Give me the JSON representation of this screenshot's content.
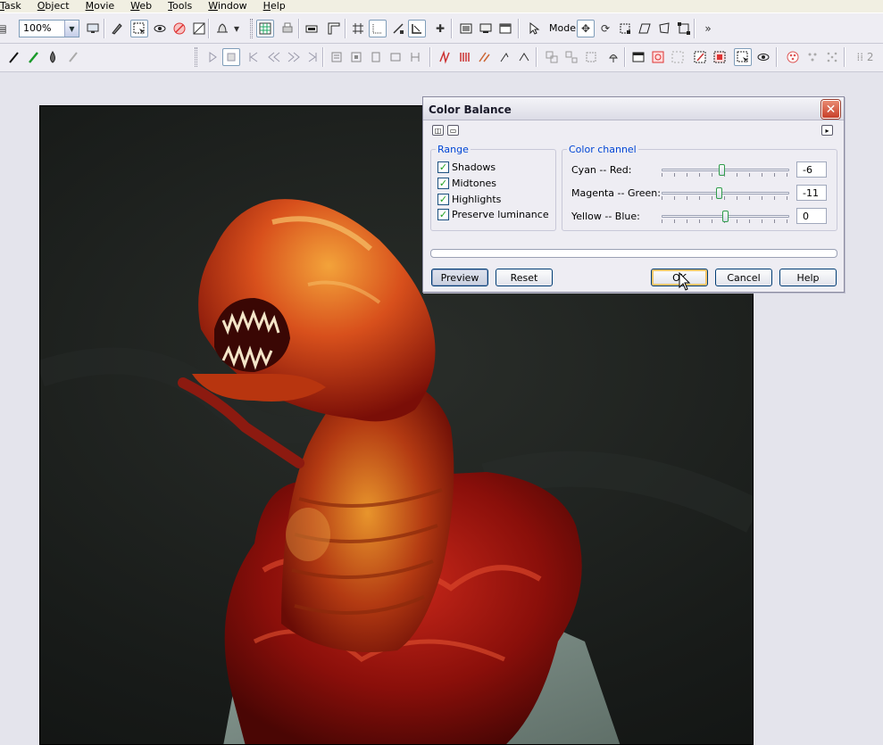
{
  "menu": {
    "items": [
      "Task",
      "Object",
      "Movie",
      "Web",
      "Tools",
      "Window",
      "Help"
    ],
    "underlined_letters": [
      "T",
      "O",
      "M",
      "W",
      "T",
      "W",
      "H"
    ]
  },
  "toolbar": {
    "zoom_value": "100%",
    "mode_label": "Mode"
  },
  "dialog": {
    "title": "Color Balance",
    "close_glyph": "✕",
    "range": {
      "legend": "Range",
      "options": [
        {
          "label": "Shadows",
          "checked": true
        },
        {
          "label": "Midtones",
          "checked": true
        },
        {
          "label": "Highlights",
          "checked": true
        },
        {
          "label": "Preserve luminance",
          "checked": true
        }
      ]
    },
    "color_channel": {
      "legend": "Color channel",
      "sliders": [
        {
          "label": "Cyan -- Red:",
          "value": "-6",
          "numeric": -6
        },
        {
          "label": "Magenta -- Green:",
          "value": "-11",
          "numeric": -11
        },
        {
          "label": "Yellow -- Blue:",
          "value": "0",
          "numeric": 0
        }
      ],
      "slider_min": -100,
      "slider_max": 100
    },
    "buttons": {
      "preview": "Preview",
      "reset": "Reset",
      "ok": "OK",
      "cancel": "Cancel",
      "help": "Help"
    }
  },
  "colors": {
    "accent_blue": "#0046d5",
    "check_green": "#21a121",
    "close_red": "#c8402a"
  },
  "icons": {
    "toolbar1": [
      "layers-icon",
      "preview-monitor-icon",
      "pen-tool-icon",
      "select-icon",
      "eye-icon",
      "no-icon",
      "crop-icon",
      "bell-icon",
      "grid-icon",
      "print-icon",
      "rectangle-icon",
      "ruler-icon",
      "guides-icon",
      "snap-icon",
      "transform-icon",
      "plus-icon",
      "window-icon",
      "monitor-icon",
      "browser-icon",
      "pointer-icon",
      "move-icon",
      "rotate-icon",
      "resize-icon",
      "skew-icon",
      "distort-icon",
      "forward-icon"
    ],
    "toolbar2": [
      "brush-icon",
      "pencil-icon",
      "drop-icon",
      "eraser-icon",
      "play-icon",
      "stop-icon",
      "first-frame-icon",
      "prev-frame-icon",
      "next-frame-icon",
      "last-frame-icon",
      "frame-icon",
      "effects-icon",
      "color-icon"
    ]
  }
}
